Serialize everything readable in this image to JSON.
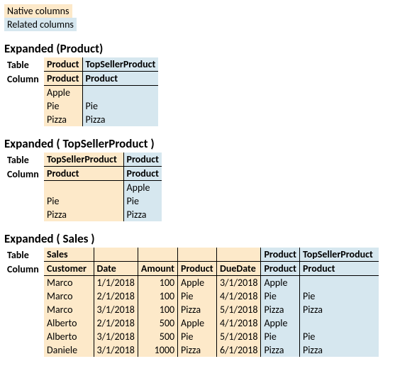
{
  "legend": {
    "native": "Native columns",
    "related": "Related columns"
  },
  "labels": {
    "table": "Table",
    "column": "Column"
  },
  "t1": {
    "title": "Expanded (Product)",
    "headers": [
      {
        "table": "Product",
        "column": "Product",
        "cls": "native"
      },
      {
        "table": "TopSellerProduct",
        "column": "Product",
        "cls": "related"
      }
    ],
    "rows": [
      [
        "Apple",
        ""
      ],
      [
        "Pie",
        "Pie"
      ],
      [
        "Pizza",
        "Pizza"
      ]
    ]
  },
  "t2": {
    "title": "Expanded ( TopSellerProduct )",
    "headers": [
      {
        "table": "TopSellerProduct",
        "column": "Product",
        "cls": "native"
      },
      {
        "table": "Product",
        "column": "Product",
        "cls": "related"
      }
    ],
    "rows": [
      [
        "",
        "Apple"
      ],
      [
        "Pie",
        "Pie"
      ],
      [
        "Pizza",
        "Pizza"
      ]
    ]
  },
  "t3": {
    "title": "Expanded ( Sales )",
    "nativeCols": [
      {
        "table": "Sales",
        "column": "Customer"
      },
      {
        "table": "",
        "column": "Date"
      },
      {
        "table": "",
        "column": "Amount"
      },
      {
        "table": "",
        "column": "Product"
      },
      {
        "table": "",
        "column": "DueDate"
      }
    ],
    "relatedCols": [
      {
        "table": "Product",
        "column": "Product"
      },
      {
        "table": "TopSellerProduct",
        "column": "Product"
      }
    ],
    "rows": [
      [
        "Marco",
        "1/1/2018",
        "100",
        "Apple",
        "3/1/2018",
        "Apple",
        ""
      ],
      [
        "Marco",
        "2/1/2018",
        "100",
        "Pie",
        "4/1/2018",
        "Pie",
        "Pie"
      ],
      [
        "Marco",
        "3/1/2018",
        "100",
        "Pizza",
        "5/1/2018",
        "Pizza",
        "Pizza"
      ],
      [
        "Alberto",
        "2/1/2018",
        "500",
        "Apple",
        "4/1/2018",
        "Apple",
        ""
      ],
      [
        "Alberto",
        "3/1/2018",
        "500",
        "Pie",
        "5/1/2018",
        "Pie",
        "Pie"
      ],
      [
        "Daniele",
        "3/1/2018",
        "1000",
        "Pizza",
        "6/1/2018",
        "Pizza",
        "Pizza"
      ]
    ]
  }
}
